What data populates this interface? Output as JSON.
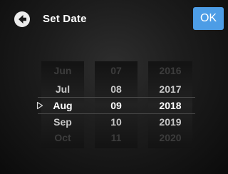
{
  "header": {
    "title": "Set Date",
    "ok_label": "OK",
    "back_icon": "arrow-left-circle-icon"
  },
  "picker": {
    "months": [
      "Jun",
      "Jul",
      "Aug",
      "Sep",
      "Oct"
    ],
    "days": [
      "07",
      "08",
      "09",
      "10",
      "11"
    ],
    "years": [
      "2016",
      "2017",
      "2018",
      "2019",
      "2020"
    ],
    "selected": {
      "month": "Aug",
      "day": "09",
      "year": "2018"
    },
    "pointer_icon": "triangle-right-outline-icon"
  },
  "colors": {
    "accent": "#4d9de6",
    "background": "#1c1c1c",
    "selected_text": "#ffffff",
    "faded_text": "#3c3c3c"
  }
}
